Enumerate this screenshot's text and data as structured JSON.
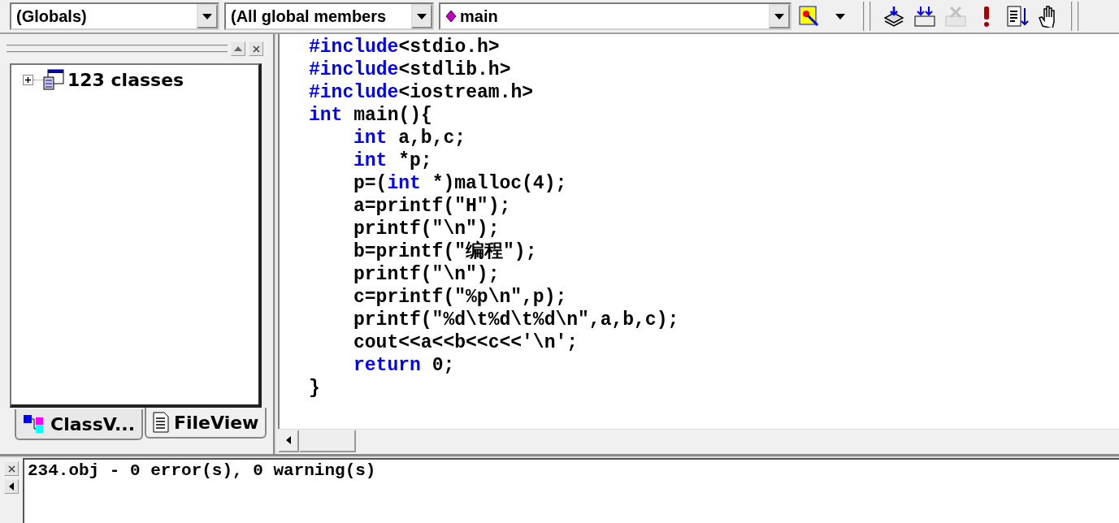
{
  "toolbar": {
    "combos": [
      {
        "kind": "plain",
        "value": "(Globals)"
      },
      {
        "kind": "plain",
        "value": "(All global members"
      },
      {
        "kind": "function",
        "value": "main"
      }
    ],
    "icons": [
      {
        "kind": "wizard",
        "disabled": false
      },
      {
        "kind": "compile",
        "disabled": false
      },
      {
        "kind": "build",
        "disabled": false
      },
      {
        "kind": "stop",
        "disabled": true
      },
      {
        "kind": "execute",
        "disabled": false
      },
      {
        "kind": "go",
        "disabled": false
      },
      {
        "kind": "breakpoint",
        "disabled": false
      }
    ]
  },
  "workspace": {
    "tree": [
      {
        "label": "123 classes",
        "expanded": false
      }
    ],
    "tabs": [
      {
        "label": "ClassV...",
        "kind": "class",
        "selected": false
      },
      {
        "label": "FileView",
        "kind": "file",
        "selected": true
      }
    ]
  },
  "editor": {
    "lines": [
      {
        "segments": [
          {
            "kind": "keyword",
            "text": "#include"
          },
          {
            "kind": "plain",
            "text": "<stdio.h>"
          }
        ]
      },
      {
        "segments": [
          {
            "kind": "keyword",
            "text": "#include"
          },
          {
            "kind": "plain",
            "text": "<stdlib.h>"
          }
        ]
      },
      {
        "segments": [
          {
            "kind": "keyword",
            "text": "#include"
          },
          {
            "kind": "plain",
            "text": "<iostream.h>"
          }
        ]
      },
      {
        "segments": [
          {
            "kind": "keyword",
            "text": "int"
          },
          {
            "kind": "plain",
            "text": " main(){"
          }
        ],
        "children": [
          {
            "segments": [
              {
                "kind": "keyword",
                "text": "int"
              },
              {
                "kind": "plain",
                "text": " a,b,c;"
              }
            ]
          },
          {
            "segments": [
              {
                "kind": "keyword",
                "text": "int"
              },
              {
                "kind": "plain",
                "text": " *p;"
              }
            ]
          },
          {
            "segments": [
              {
                "kind": "plain",
                "text": "p=("
              },
              {
                "kind": "keyword",
                "text": "int"
              },
              {
                "kind": "plain",
                "text": " *)malloc(4);"
              }
            ]
          },
          {
            "segments": [
              {
                "kind": "plain",
                "text": "a=printf(\"H\");"
              }
            ]
          },
          {
            "segments": [
              {
                "kind": "plain",
                "text": "printf(\"\\n\");"
              }
            ]
          },
          {
            "segments": [
              {
                "kind": "plain",
                "text": "b=printf(\"编程\");"
              }
            ]
          },
          {
            "segments": [
              {
                "kind": "plain",
                "text": "printf(\"\\n\");"
              }
            ]
          },
          {
            "segments": [
              {
                "kind": "plain",
                "text": "c=printf(\"%p\\n\",p);"
              }
            ]
          },
          {
            "segments": [
              {
                "kind": "plain",
                "text": "printf(\"%d\\t%d\\t%d\\n\",a,b,c);"
              }
            ]
          },
          {
            "segments": [
              {
                "kind": "plain",
                "text": "cout<<a<<b<<c<<'\\n';"
              }
            ]
          },
          {
            "segments": [
              {
                "kind": "keyword",
                "text": "return"
              },
              {
                "kind": "plain",
                "text": " 0;"
              }
            ]
          }
        ]
      },
      {
        "segments": [
          {
            "kind": "plain",
            "text": "}"
          }
        ]
      }
    ]
  },
  "output": {
    "text": "234.obj - 0 error(s), 0 warning(s)"
  }
}
